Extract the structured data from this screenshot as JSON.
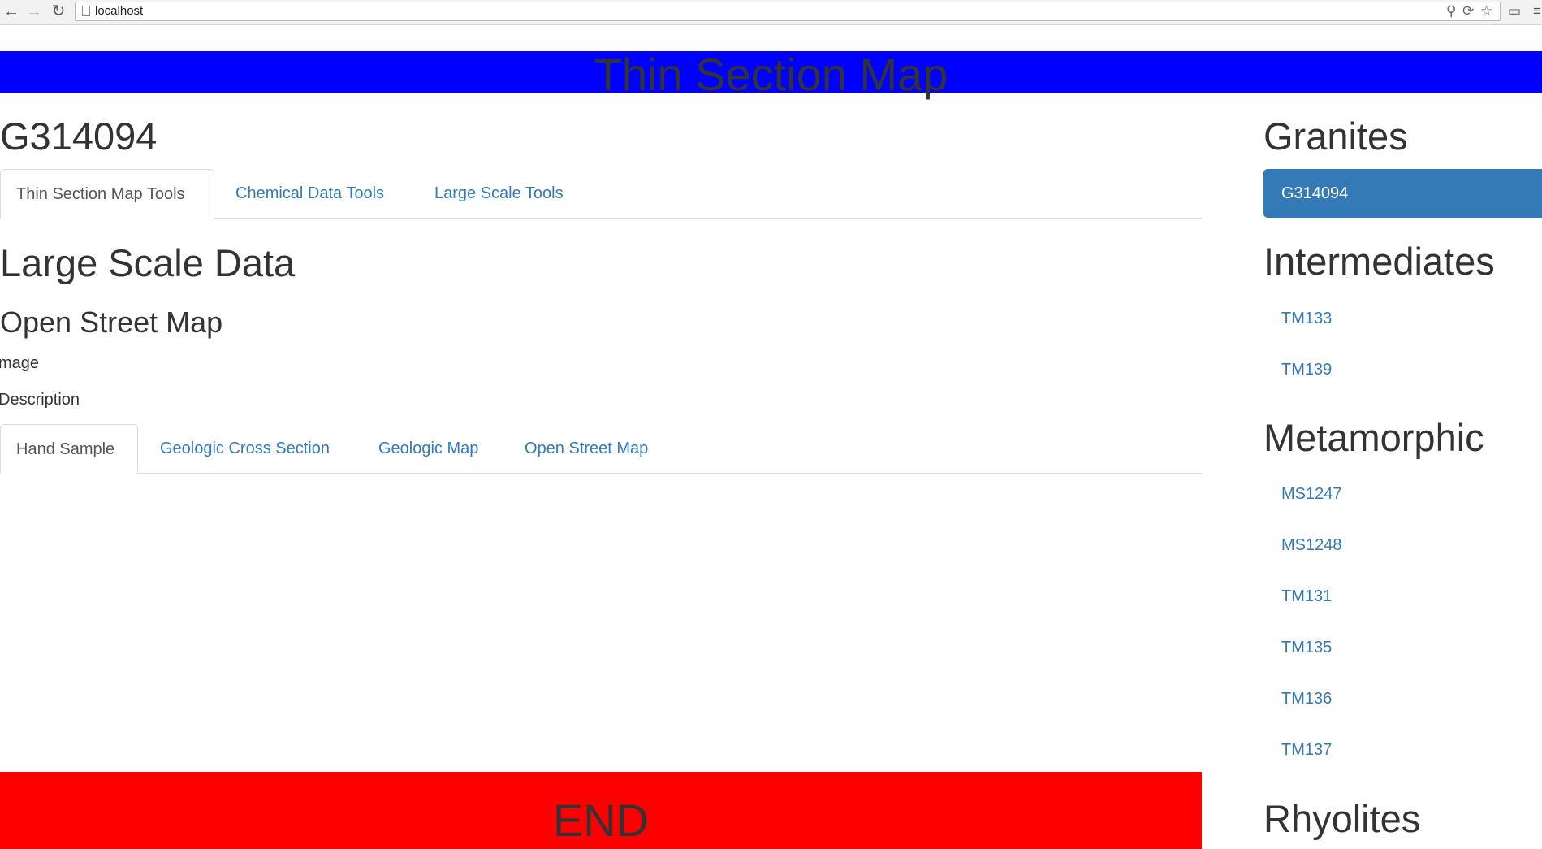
{
  "browser": {
    "url": "localhost",
    "back_icon": "arrow-left-icon",
    "forward_icon": "arrow-right-icon",
    "reload_icon": "reload-icon"
  },
  "header": {
    "title": "Thin Section Map",
    "background_color": "#0000ff"
  },
  "main": {
    "sample_title": "G314094",
    "tool_tabs": [
      {
        "label": "Thin Section Map Tools",
        "active": true
      },
      {
        "label": "Chemical Data Tools",
        "active": false
      },
      {
        "label": "Large Scale Tools",
        "active": false
      }
    ],
    "section_title": "Large Scale Data",
    "subsection_title": "Open Street Map",
    "image_label": "mage",
    "description_label": "Description",
    "data_tabs": [
      {
        "label": "Hand Sample",
        "active": true
      },
      {
        "label": "Geologic Cross Section",
        "active": false
      },
      {
        "label": "Geologic Map",
        "active": false
      },
      {
        "label": "Open Street Map",
        "active": false
      }
    ]
  },
  "footer": {
    "text": "END",
    "background_color": "#ff0000"
  },
  "sidebar": {
    "groups": [
      {
        "heading": "Granites",
        "items": [
          {
            "label": "G314094",
            "active": true
          }
        ]
      },
      {
        "heading": "Intermediates",
        "items": [
          {
            "label": "TM133"
          },
          {
            "label": "TM139"
          }
        ]
      },
      {
        "heading": "Metamorphic",
        "items": [
          {
            "label": "MS1247"
          },
          {
            "label": "MS1248"
          },
          {
            "label": "TM131"
          },
          {
            "label": "TM135"
          },
          {
            "label": "TM136"
          },
          {
            "label": "TM137"
          }
        ]
      },
      {
        "heading": "Rhyolites",
        "items": []
      }
    ],
    "accent_color": "#337ab7"
  }
}
